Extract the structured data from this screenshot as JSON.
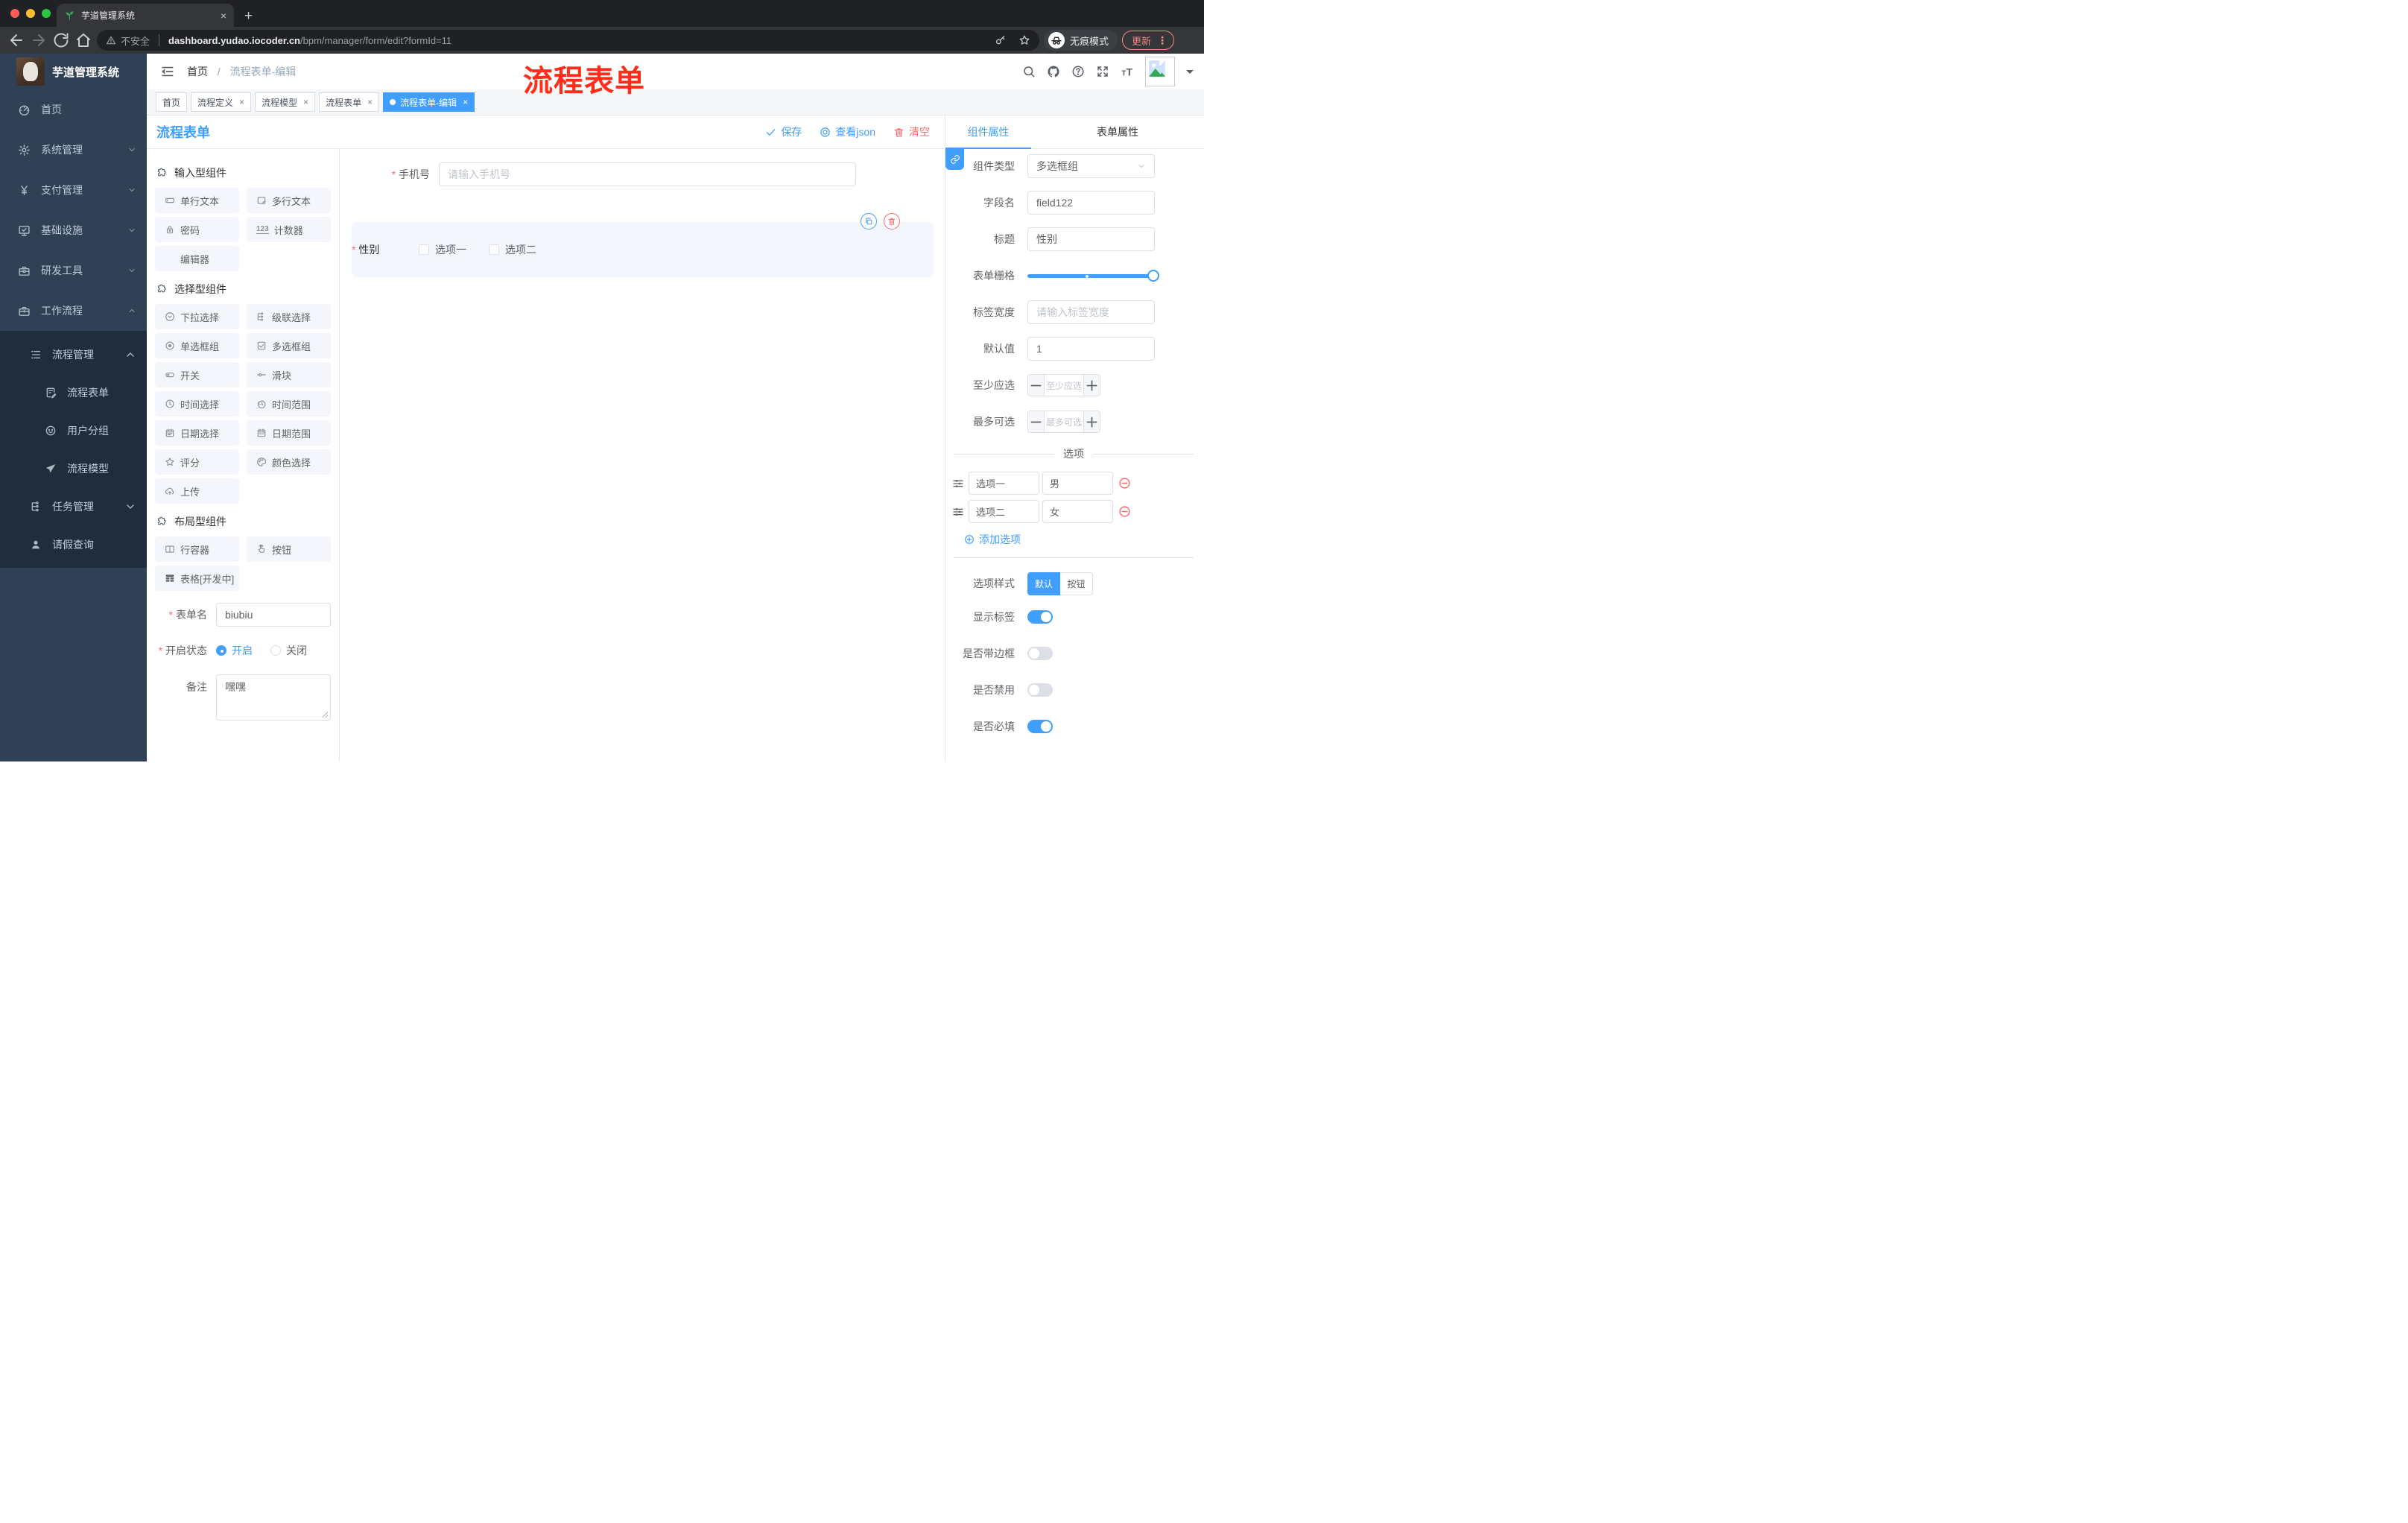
{
  "colors": {
    "primary": "#409EFF",
    "danger": "#F56C6C",
    "annotation": "#FF2D1A",
    "sidebar_bg": "#304156",
    "submenu_bg": "#1F2D3D"
  },
  "browser": {
    "tab_title": "芋道管理系统",
    "new_tab": "+",
    "security_label": "不安全",
    "url_domain": "dashboard.yudao.iocoder.cn",
    "url_path": "/bpm/manager/form/edit?formId=11",
    "incognito_label": "无痕模式",
    "update_label": "更新",
    "menu_dots": "⋮"
  },
  "sidebar": {
    "brand": "芋道管理系统",
    "items": [
      {
        "label": "首页",
        "icon": "dashboard-icon"
      },
      {
        "label": "系统管理",
        "icon": "gear-icon",
        "state": "collapsed"
      },
      {
        "label": "支付管理",
        "icon": "yen-icon",
        "state": "collapsed"
      },
      {
        "label": "基础设施",
        "icon": "monitor-icon",
        "state": "collapsed"
      },
      {
        "label": "研发工具",
        "icon": "toolbox-icon",
        "state": "collapsed"
      },
      {
        "label": "工作流程",
        "icon": "briefcase-icon",
        "state": "expanded"
      }
    ],
    "submenu": [
      {
        "label": "流程管理",
        "icon": "list-tree-icon",
        "state": "expanded",
        "level": 1
      },
      {
        "label": "流程表单",
        "icon": "doc-edit-icon",
        "level": 2
      },
      {
        "label": "用户分组",
        "icon": "face-icon",
        "level": 2
      },
      {
        "label": "流程模型",
        "icon": "plane-icon",
        "level": 2
      },
      {
        "label": "任务管理",
        "icon": "branch-icon",
        "state": "collapsed",
        "level": 1
      },
      {
        "label": "请假查询",
        "icon": "user-icon",
        "level": 1
      }
    ]
  },
  "header": {
    "breadcrumb_home": "首页",
    "breadcrumb_sep": "/",
    "breadcrumb_current": "流程表单-编辑",
    "annotation": "流程表单"
  },
  "tags": [
    {
      "label": "首页",
      "closable": false,
      "active": false
    },
    {
      "label": "流程定义",
      "closable": true,
      "active": false
    },
    {
      "label": "流程模型",
      "closable": true,
      "active": false
    },
    {
      "label": "流程表单",
      "closable": true,
      "active": false
    },
    {
      "label": "流程表单-编辑",
      "closable": true,
      "active": true
    }
  ],
  "close_glyph": "×",
  "designer": {
    "title": "流程表单",
    "actions": {
      "save": "保存",
      "view_json": "查看json",
      "clear": "清空"
    },
    "groups": [
      {
        "title": "输入型组件",
        "items": [
          {
            "label": "单行文本",
            "icon": "input-icon"
          },
          {
            "label": "多行文本",
            "icon": "textarea-icon"
          },
          {
            "label": "密码",
            "icon": "lock-icon"
          },
          {
            "label": "计数器",
            "icon": "number-icon"
          },
          {
            "label": "编辑器",
            "icon": "none"
          }
        ]
      },
      {
        "title": "选择型组件",
        "items": [
          {
            "label": "下拉选择",
            "icon": "select-icon"
          },
          {
            "label": "级联选择",
            "icon": "cascader-icon"
          },
          {
            "label": "单选框组",
            "icon": "radio-icon"
          },
          {
            "label": "多选框组",
            "icon": "checkbox-icon"
          },
          {
            "label": "开关",
            "icon": "switch-icon"
          },
          {
            "label": "滑块",
            "icon": "slider-icon"
          },
          {
            "label": "时间选择",
            "icon": "time-icon"
          },
          {
            "label": "时间范围",
            "icon": "time-range-icon"
          },
          {
            "label": "日期选择",
            "icon": "date-icon"
          },
          {
            "label": "日期范围",
            "icon": "date-range-icon"
          },
          {
            "label": "评分",
            "icon": "rate-icon"
          },
          {
            "label": "颜色选择",
            "icon": "color-icon"
          },
          {
            "label": "上传",
            "icon": "upload-icon"
          }
        ]
      },
      {
        "title": "布局型组件",
        "items": [
          {
            "label": "行容器",
            "icon": "row-icon"
          },
          {
            "label": "按钮",
            "icon": "button-icon"
          },
          {
            "label": "表格[开发中]",
            "icon": "table-icon"
          }
        ]
      }
    ],
    "meta_form": {
      "name_label": "表单名",
      "name_value": "biubiu",
      "status_label": "开启状态",
      "status_on": "开启",
      "status_off": "关闭",
      "status_value": "开启",
      "remark_label": "备注",
      "remark_value": "嘿嘿"
    }
  },
  "canvas": {
    "phone_field": {
      "label": "手机号",
      "required": true,
      "placeholder": "请输入手机号"
    },
    "gender_field": {
      "label": "性别",
      "required": true,
      "selected": true,
      "option1": "选项一",
      "option2": "选项二"
    }
  },
  "inspector": {
    "tab_component": "组件属性",
    "tab_form": "表单属性",
    "active_tab": "组件属性",
    "component_type": {
      "label": "组件类型",
      "value": "多选框组"
    },
    "field_name": {
      "label": "字段名",
      "value": "field122"
    },
    "title_row": {
      "label": "标题",
      "value": "性别"
    },
    "grid_row": {
      "label": "表单栅格",
      "value": 24,
      "max": 24,
      "mark": 12
    },
    "label_width": {
      "label": "标签宽度",
      "placeholder": "请输入标签宽度"
    },
    "default_value": {
      "label": "默认值",
      "value": "1"
    },
    "min_select": {
      "label": "至少应选",
      "placeholder": "至少应选"
    },
    "max_select": {
      "label": "最多可选",
      "placeholder": "最多可选"
    },
    "options": {
      "divider": "选项",
      "rows": [
        {
          "label": "选项一",
          "value": "男"
        },
        {
          "label": "选项二",
          "value": "女"
        }
      ],
      "add_label": "添加选项"
    },
    "option_style": {
      "label": "选项样式",
      "opt_default": "默认",
      "opt_button": "按钮",
      "selected": "默认"
    },
    "toggles": [
      {
        "label": "显示标签",
        "on": true
      },
      {
        "label": "是否带边框",
        "on": false
      },
      {
        "label": "是否禁用",
        "on": false
      },
      {
        "label": "是否必填",
        "on": true
      }
    ]
  },
  "icons": {
    "check-icon": "✓",
    "close-icon": "×",
    "plus-icon": "+",
    "minus-icon": "−",
    "caret-down-icon": "▾",
    "kebab-icon": "⋮",
    "number-icon": "123"
  }
}
